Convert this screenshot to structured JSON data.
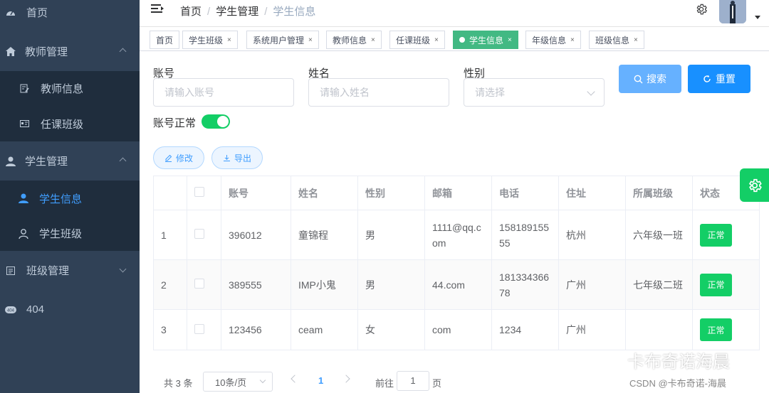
{
  "sidebar": {
    "items": [
      {
        "label": "首页",
        "icon": "dashboard-icon"
      },
      {
        "label": "教师管理",
        "icon": "home-icon",
        "expanded": true
      },
      {
        "label": "教师信息",
        "icon": "edit-doc-icon"
      },
      {
        "label": "任课班级",
        "icon": "id-card-icon"
      },
      {
        "label": "学生管理",
        "icon": "user-icon",
        "expanded": true
      },
      {
        "label": "学生信息",
        "icon": "user-icon",
        "active": true
      },
      {
        "label": "学生班级",
        "icon": "user-outline-icon"
      },
      {
        "label": "班级管理",
        "icon": "list-icon",
        "expanded": false
      },
      {
        "label": "404",
        "icon": "404-icon"
      }
    ]
  },
  "navbar": {
    "breadcrumb": [
      "首页",
      "学生管理",
      "学生信息"
    ]
  },
  "tags": [
    "首页",
    "学生班级",
    "系统用户管理",
    "教师信息",
    "任课班级",
    "学生信息",
    "年级信息",
    "班级信息"
  ],
  "search": {
    "account_label": "账号",
    "account_placeholder": "请输入账号",
    "name_label": "姓名",
    "name_placeholder": "请输入姓名",
    "gender_label": "性别",
    "gender_placeholder": "请选择",
    "status_label": "账号正常",
    "status_on": true,
    "search_button": "搜索",
    "reset_button": "重置"
  },
  "actions": {
    "edit": "修改",
    "export": "导出"
  },
  "table": {
    "headers": [
      "",
      "",
      "账号",
      "姓名",
      "性别",
      "邮箱",
      "电话",
      "住址",
      "所属班级",
      "状态"
    ],
    "rows": [
      {
        "index": "1",
        "account": "396012",
        "name": "童锦程",
        "gender": "男",
        "email": "1111@qq.com",
        "phone": "15818915555",
        "address": "杭州",
        "class": "六年级一班",
        "status": "正常"
      },
      {
        "index": "2",
        "account": "389555",
        "name": "IMP小鬼",
        "gender": "男",
        "email": "44.com",
        "phone": "18133436678",
        "address": "广州",
        "class": "七年级二班",
        "status": "正常"
      },
      {
        "index": "3",
        "account": "123456",
        "name": "ceam",
        "gender": "女",
        "email": "com",
        "phone": "1234",
        "address": "广州",
        "class": "",
        "status": "正常"
      }
    ]
  },
  "pagination": {
    "total": "共 3 条",
    "page_size": "10条/页",
    "current": "1",
    "goto_label": "前往",
    "goto_value": "1",
    "page_suffix": "页"
  },
  "watermark": {
    "main": "卡布奇诺海晨",
    "sub": "CSDN @卡布奇诺-海晨"
  },
  "colors": {
    "sidebar_bg": "#304156",
    "accent": "#409eff",
    "success": "#13ce66",
    "tag_active": "#42b983"
  }
}
